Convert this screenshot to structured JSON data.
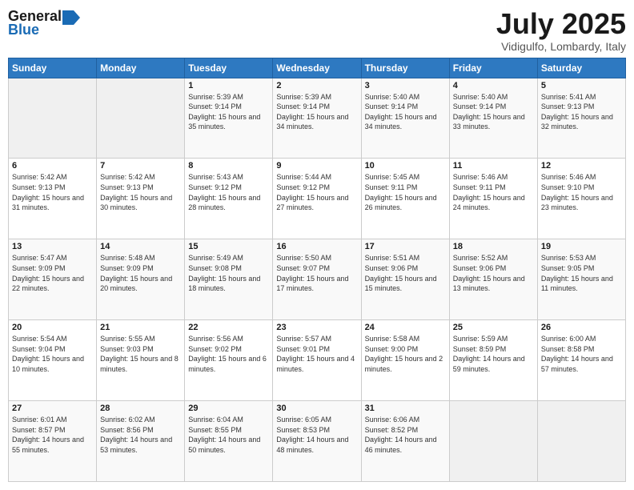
{
  "header": {
    "logo_general": "General",
    "logo_blue": "Blue",
    "month_title": "July 2025",
    "location": "Vidigulfo, Lombardy, Italy"
  },
  "days_of_week": [
    "Sunday",
    "Monday",
    "Tuesday",
    "Wednesday",
    "Thursday",
    "Friday",
    "Saturday"
  ],
  "weeks": [
    [
      {
        "num": "",
        "sunrise": "",
        "sunset": "",
        "daylight": ""
      },
      {
        "num": "",
        "sunrise": "",
        "sunset": "",
        "daylight": ""
      },
      {
        "num": "1",
        "sunrise": "Sunrise: 5:39 AM",
        "sunset": "Sunset: 9:14 PM",
        "daylight": "Daylight: 15 hours and 35 minutes."
      },
      {
        "num": "2",
        "sunrise": "Sunrise: 5:39 AM",
        "sunset": "Sunset: 9:14 PM",
        "daylight": "Daylight: 15 hours and 34 minutes."
      },
      {
        "num": "3",
        "sunrise": "Sunrise: 5:40 AM",
        "sunset": "Sunset: 9:14 PM",
        "daylight": "Daylight: 15 hours and 34 minutes."
      },
      {
        "num": "4",
        "sunrise": "Sunrise: 5:40 AM",
        "sunset": "Sunset: 9:14 PM",
        "daylight": "Daylight: 15 hours and 33 minutes."
      },
      {
        "num": "5",
        "sunrise": "Sunrise: 5:41 AM",
        "sunset": "Sunset: 9:13 PM",
        "daylight": "Daylight: 15 hours and 32 minutes."
      }
    ],
    [
      {
        "num": "6",
        "sunrise": "Sunrise: 5:42 AM",
        "sunset": "Sunset: 9:13 PM",
        "daylight": "Daylight: 15 hours and 31 minutes."
      },
      {
        "num": "7",
        "sunrise": "Sunrise: 5:42 AM",
        "sunset": "Sunset: 9:13 PM",
        "daylight": "Daylight: 15 hours and 30 minutes."
      },
      {
        "num": "8",
        "sunrise": "Sunrise: 5:43 AM",
        "sunset": "Sunset: 9:12 PM",
        "daylight": "Daylight: 15 hours and 28 minutes."
      },
      {
        "num": "9",
        "sunrise": "Sunrise: 5:44 AM",
        "sunset": "Sunset: 9:12 PM",
        "daylight": "Daylight: 15 hours and 27 minutes."
      },
      {
        "num": "10",
        "sunrise": "Sunrise: 5:45 AM",
        "sunset": "Sunset: 9:11 PM",
        "daylight": "Daylight: 15 hours and 26 minutes."
      },
      {
        "num": "11",
        "sunrise": "Sunrise: 5:46 AM",
        "sunset": "Sunset: 9:11 PM",
        "daylight": "Daylight: 15 hours and 24 minutes."
      },
      {
        "num": "12",
        "sunrise": "Sunrise: 5:46 AM",
        "sunset": "Sunset: 9:10 PM",
        "daylight": "Daylight: 15 hours and 23 minutes."
      }
    ],
    [
      {
        "num": "13",
        "sunrise": "Sunrise: 5:47 AM",
        "sunset": "Sunset: 9:09 PM",
        "daylight": "Daylight: 15 hours and 22 minutes."
      },
      {
        "num": "14",
        "sunrise": "Sunrise: 5:48 AM",
        "sunset": "Sunset: 9:09 PM",
        "daylight": "Daylight: 15 hours and 20 minutes."
      },
      {
        "num": "15",
        "sunrise": "Sunrise: 5:49 AM",
        "sunset": "Sunset: 9:08 PM",
        "daylight": "Daylight: 15 hours and 18 minutes."
      },
      {
        "num": "16",
        "sunrise": "Sunrise: 5:50 AM",
        "sunset": "Sunset: 9:07 PM",
        "daylight": "Daylight: 15 hours and 17 minutes."
      },
      {
        "num": "17",
        "sunrise": "Sunrise: 5:51 AM",
        "sunset": "Sunset: 9:06 PM",
        "daylight": "Daylight: 15 hours and 15 minutes."
      },
      {
        "num": "18",
        "sunrise": "Sunrise: 5:52 AM",
        "sunset": "Sunset: 9:06 PM",
        "daylight": "Daylight: 15 hours and 13 minutes."
      },
      {
        "num": "19",
        "sunrise": "Sunrise: 5:53 AM",
        "sunset": "Sunset: 9:05 PM",
        "daylight": "Daylight: 15 hours and 11 minutes."
      }
    ],
    [
      {
        "num": "20",
        "sunrise": "Sunrise: 5:54 AM",
        "sunset": "Sunset: 9:04 PM",
        "daylight": "Daylight: 15 hours and 10 minutes."
      },
      {
        "num": "21",
        "sunrise": "Sunrise: 5:55 AM",
        "sunset": "Sunset: 9:03 PM",
        "daylight": "Daylight: 15 hours and 8 minutes."
      },
      {
        "num": "22",
        "sunrise": "Sunrise: 5:56 AM",
        "sunset": "Sunset: 9:02 PM",
        "daylight": "Daylight: 15 hours and 6 minutes."
      },
      {
        "num": "23",
        "sunrise": "Sunrise: 5:57 AM",
        "sunset": "Sunset: 9:01 PM",
        "daylight": "Daylight: 15 hours and 4 minutes."
      },
      {
        "num": "24",
        "sunrise": "Sunrise: 5:58 AM",
        "sunset": "Sunset: 9:00 PM",
        "daylight": "Daylight: 15 hours and 2 minutes."
      },
      {
        "num": "25",
        "sunrise": "Sunrise: 5:59 AM",
        "sunset": "Sunset: 8:59 PM",
        "daylight": "Daylight: 14 hours and 59 minutes."
      },
      {
        "num": "26",
        "sunrise": "Sunrise: 6:00 AM",
        "sunset": "Sunset: 8:58 PM",
        "daylight": "Daylight: 14 hours and 57 minutes."
      }
    ],
    [
      {
        "num": "27",
        "sunrise": "Sunrise: 6:01 AM",
        "sunset": "Sunset: 8:57 PM",
        "daylight": "Daylight: 14 hours and 55 minutes."
      },
      {
        "num": "28",
        "sunrise": "Sunrise: 6:02 AM",
        "sunset": "Sunset: 8:56 PM",
        "daylight": "Daylight: 14 hours and 53 minutes."
      },
      {
        "num": "29",
        "sunrise": "Sunrise: 6:04 AM",
        "sunset": "Sunset: 8:55 PM",
        "daylight": "Daylight: 14 hours and 50 minutes."
      },
      {
        "num": "30",
        "sunrise": "Sunrise: 6:05 AM",
        "sunset": "Sunset: 8:53 PM",
        "daylight": "Daylight: 14 hours and 48 minutes."
      },
      {
        "num": "31",
        "sunrise": "Sunrise: 6:06 AM",
        "sunset": "Sunset: 8:52 PM",
        "daylight": "Daylight: 14 hours and 46 minutes."
      },
      {
        "num": "",
        "sunrise": "",
        "sunset": "",
        "daylight": ""
      },
      {
        "num": "",
        "sunrise": "",
        "sunset": "",
        "daylight": ""
      }
    ]
  ]
}
